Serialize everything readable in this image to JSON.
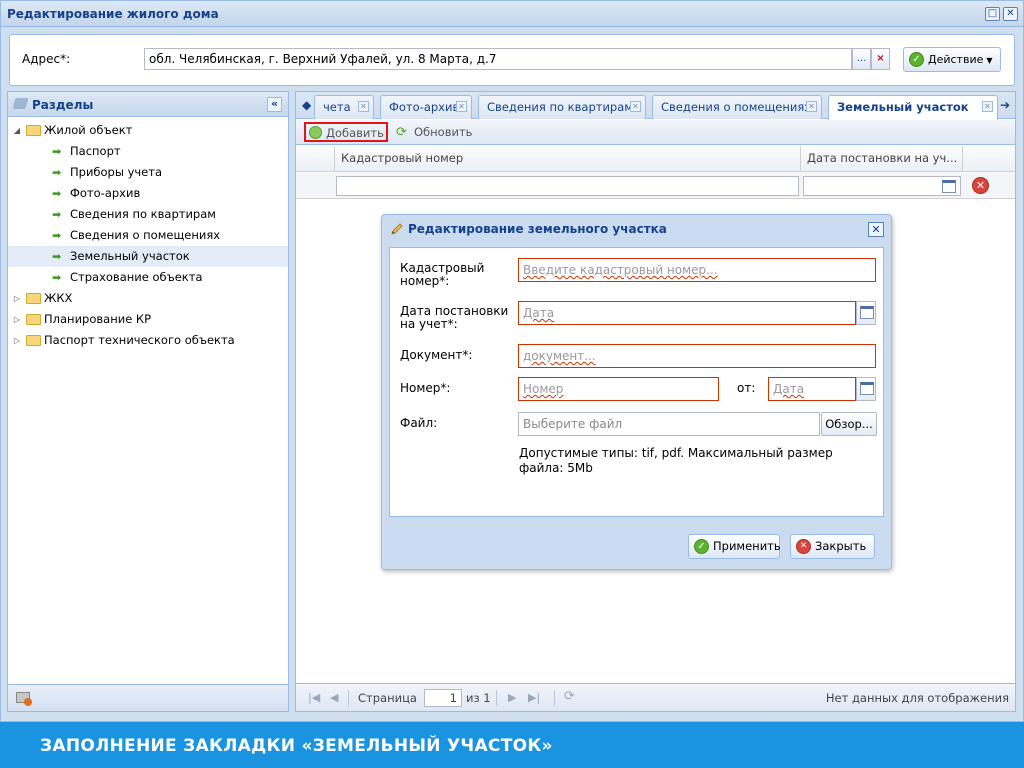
{
  "window": {
    "title": "Редактирование жилого дома"
  },
  "address": {
    "label": "Адрес*:",
    "value": "обл. Челябинская, г. Верхний Уфалей, ул. 8 Марта, д.7",
    "more_button": "...",
    "clear_button": "×",
    "action_button": "Действие"
  },
  "sidebar": {
    "title": "Разделы",
    "items": [
      {
        "label": "Жилой объект",
        "type": "folder",
        "expanded": true
      },
      {
        "label": "Паспорт",
        "type": "leaf"
      },
      {
        "label": "Приборы учета",
        "type": "leaf"
      },
      {
        "label": "Фото-архив",
        "type": "leaf"
      },
      {
        "label": "Сведения по квартирам",
        "type": "leaf"
      },
      {
        "label": "Сведения о помещениях",
        "type": "leaf"
      },
      {
        "label": "Земельный участок",
        "type": "leaf",
        "selected": true
      },
      {
        "label": "Страхование объекта",
        "type": "leaf"
      },
      {
        "label": "ЖКХ",
        "type": "folder",
        "expanded": false
      },
      {
        "label": "Планирование КР",
        "type": "folder",
        "expanded": false
      },
      {
        "label": "Паспорт технического объекта",
        "type": "folder",
        "expanded": false
      }
    ]
  },
  "tabs": [
    {
      "label": "чета"
    },
    {
      "label": "Фото-архив"
    },
    {
      "label": "Сведения по квартирам"
    },
    {
      "label": "Сведения о помещениях"
    },
    {
      "label": "Земельный участок",
      "active": true
    }
  ],
  "toolbar": {
    "add_label": "Добавить",
    "refresh_label": "Обновить"
  },
  "grid": {
    "columns": [
      "Кадастровый номер",
      "Дата постановки на уч..."
    ]
  },
  "pager": {
    "page_label": "Страница",
    "page_value": "1",
    "of_label": "из 1",
    "empty_text": "Нет данных для отображения"
  },
  "dialog": {
    "title": "Редактирование земельного участка",
    "fields": {
      "cadastral_label": "Кадастровый номер*:",
      "cadastral_placeholder": "Введите кадастровый номер...",
      "date_label": "Дата постановки на учет*:",
      "date_placeholder": "Дата",
      "document_label": "Документ*:",
      "document_placeholder": "документ...",
      "number_label": "Номер*:",
      "number_placeholder": "Номер",
      "from_label": "от:",
      "from_placeholder": "Дата",
      "file_label": "Файл:",
      "file_placeholder": "Выберите файл",
      "browse_label": "Обзор...",
      "hint": "Допустимые типы: tif, pdf. Максимальный размер файла: 5Mb"
    },
    "apply_label": "Применить",
    "close_label": "Закрыть"
  },
  "banner": {
    "text": "ЗАПОЛНЕНИЕ ЗАКЛАДКИ «ЗЕМЕЛЬНЫЙ УЧАСТОК»",
    "color": "#1a94e0"
  },
  "colors": {
    "accent": "#15428b",
    "border": "#99bbe8",
    "error": "#cc3300",
    "highlight": "#e01616"
  }
}
